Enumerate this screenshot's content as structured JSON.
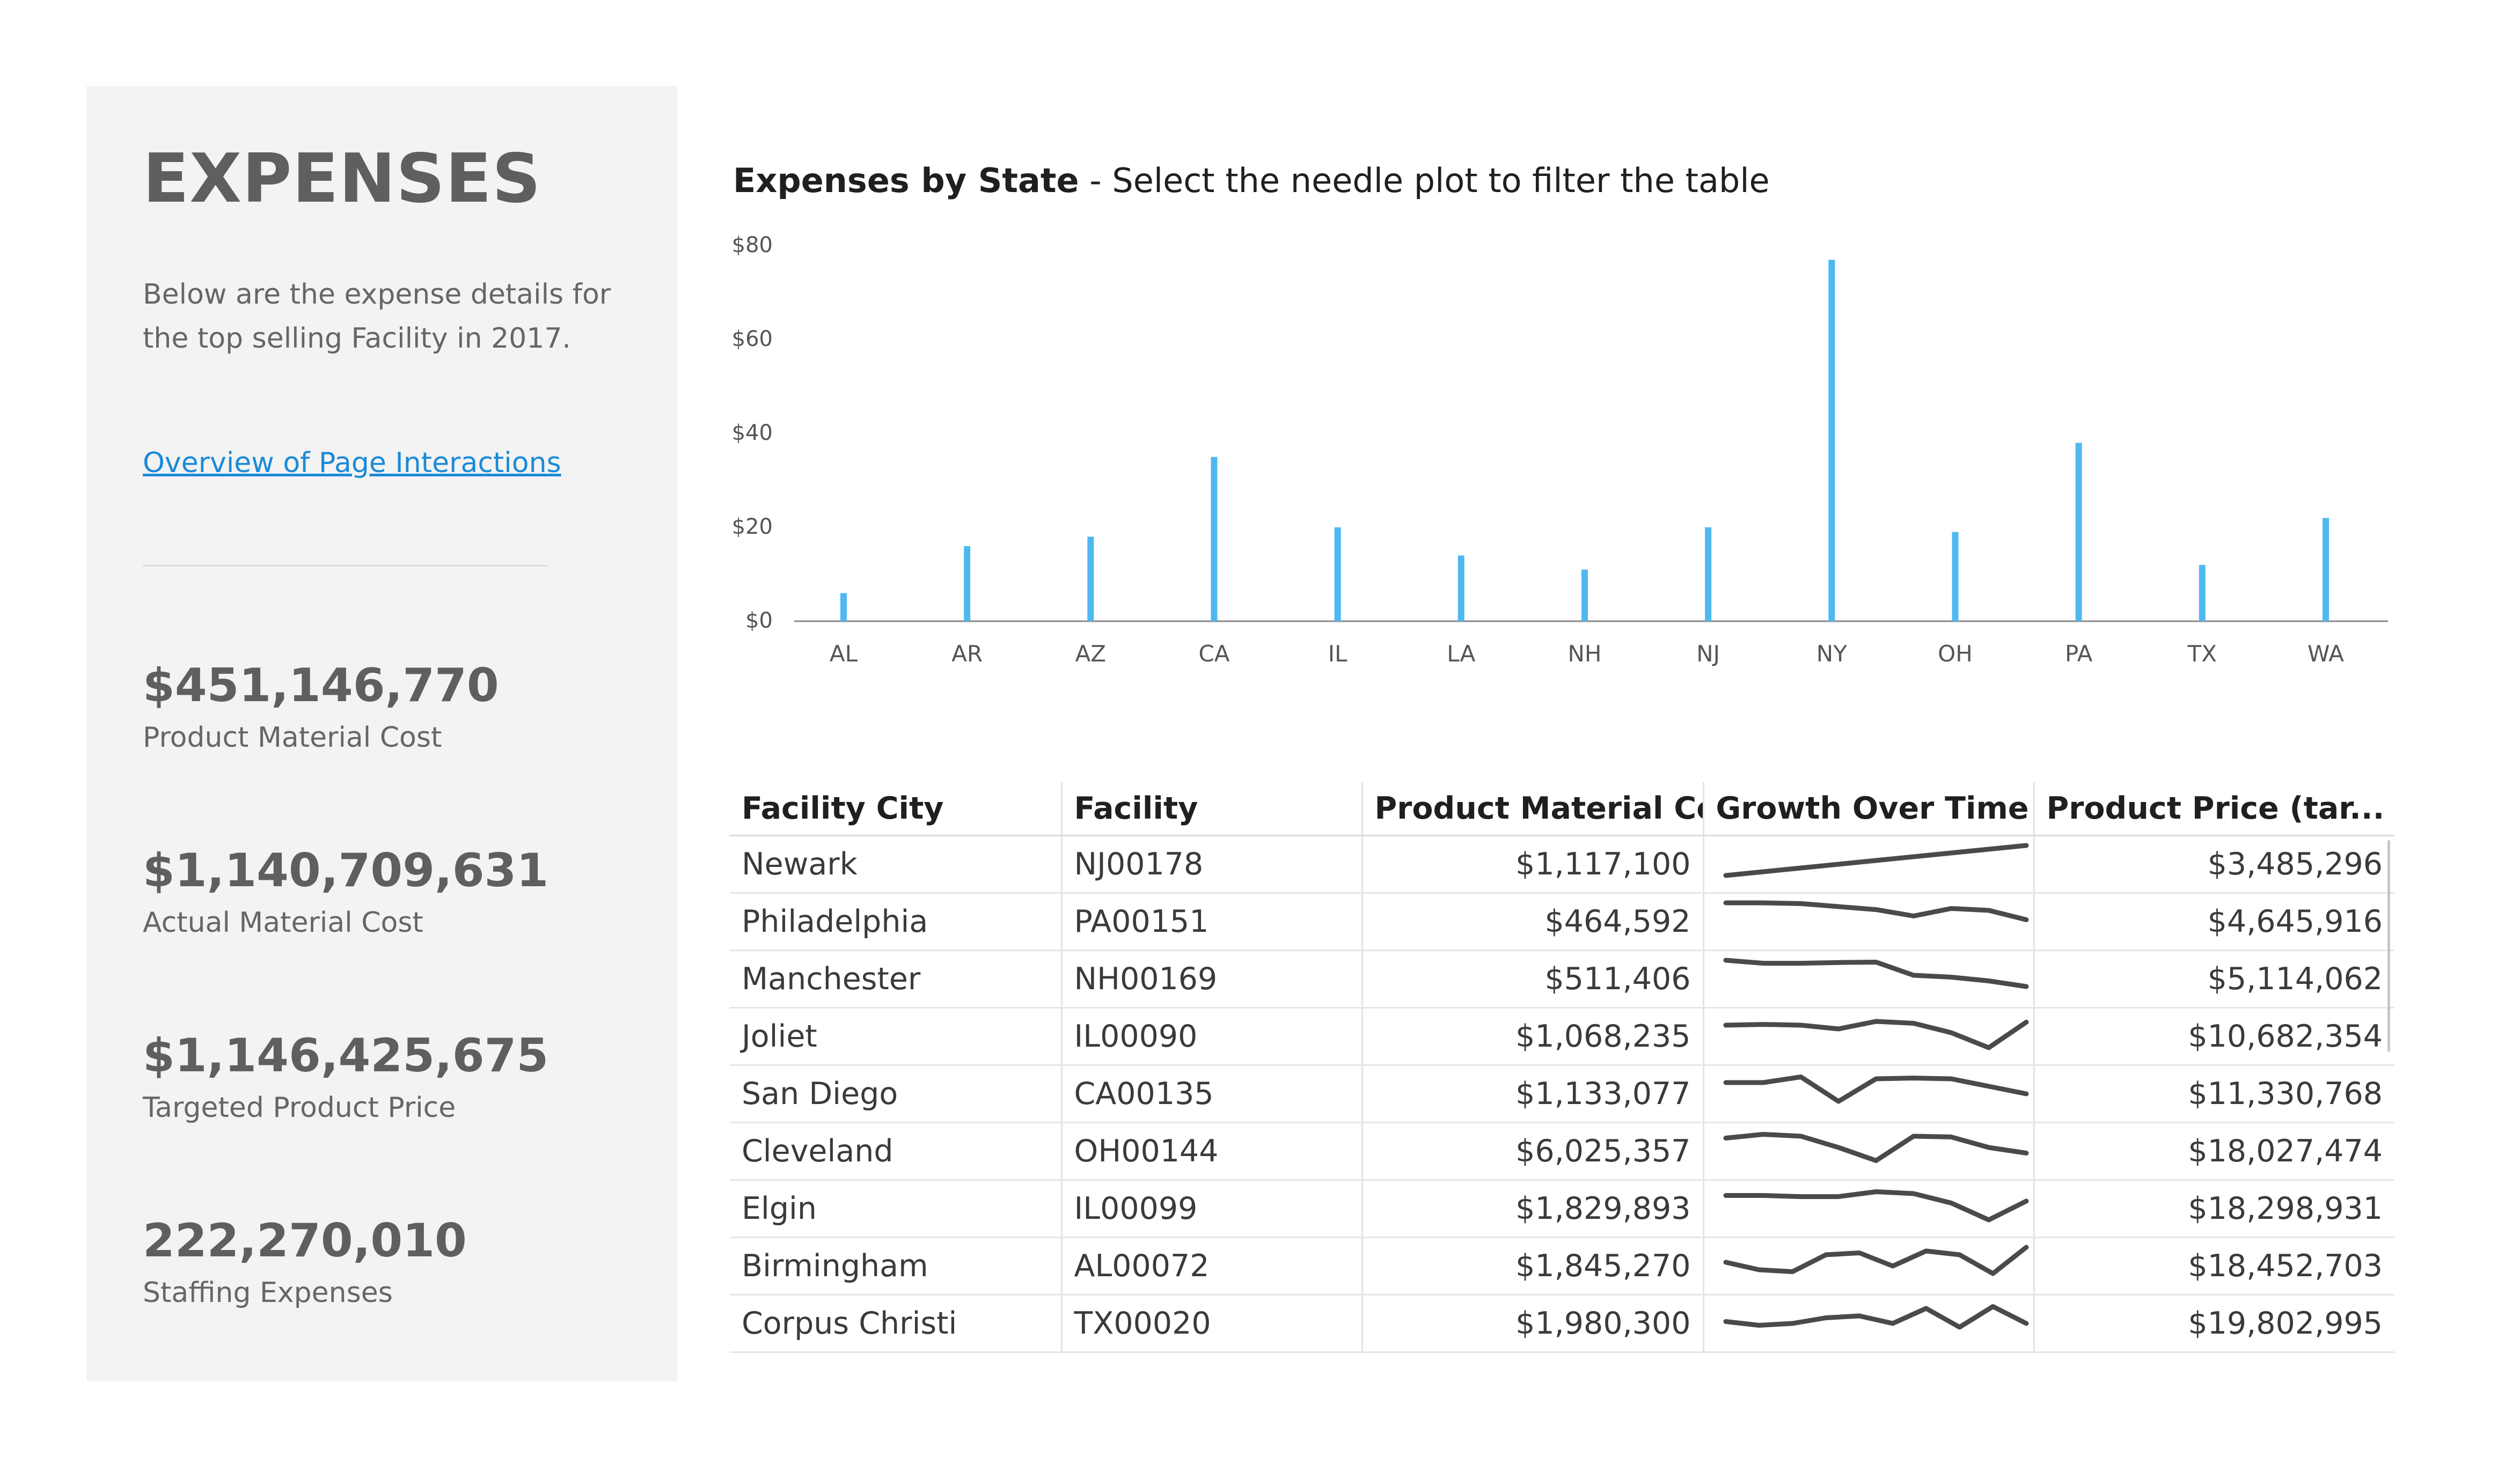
{
  "sidebar": {
    "title": "EXPENSES",
    "description": "Below are the expense details for the top selling Facility in 2017.",
    "link": "Overview of Page Interactions",
    "kpis": [
      {
        "value": "$451,146,770",
        "label": "Product Material Cost"
      },
      {
        "value": "$1,140,709,631",
        "label": "Actual Material Cost"
      },
      {
        "value": "$1,146,425,675",
        "label": "Targeted Product Price"
      },
      {
        "value": "222,270,010",
        "label": "Staffing Expenses"
      }
    ]
  },
  "chart": {
    "title_bold": "Expenses by State",
    "title_rest": " - Select the needle plot to filter the table"
  },
  "chart_data": {
    "type": "bar",
    "style": "needle",
    "title": "Expenses by State - Select the needle plot to filter the table",
    "xlabel": "",
    "ylabel": "",
    "categories": [
      "AL",
      "AR",
      "AZ",
      "CA",
      "IL",
      "LA",
      "NH",
      "NJ",
      "NY",
      "OH",
      "PA",
      "TX",
      "WA"
    ],
    "values": [
      6,
      16,
      18,
      35,
      20,
      14,
      11,
      20,
      77,
      19,
      38,
      12,
      22
    ],
    "ylim": [
      0,
      80
    ],
    "yticks": [
      "$0",
      "$20",
      "$40",
      "$60",
      "$80"
    ],
    "color": "#4fb8f0",
    "grid": false
  },
  "table": {
    "columns": [
      "Facility City",
      "Facility",
      "Product Material Cost",
      "Growth Over Time",
      "Product Price (tar..."
    ],
    "sort_indicator": "▲",
    "green_color": "#72b526",
    "rows": [
      {
        "city": "Newark",
        "facility": "NJ00178",
        "cost": "$1,117,100",
        "green": true,
        "price": "$3,485,296",
        "spark": [
          0.1,
          0.2,
          0.3,
          0.4,
          0.5,
          0.6,
          0.7,
          0.8,
          0.9
        ]
      },
      {
        "city": "Philadelphia",
        "facility": "PA00151",
        "cost": "$464,592",
        "green": false,
        "price": "$4,645,916",
        "spark": [
          0.9,
          0.9,
          0.88,
          0.8,
          0.72,
          0.55,
          0.75,
          0.7,
          0.45
        ]
      },
      {
        "city": "Manchester",
        "facility": "NH00169",
        "cost": "$511,406",
        "green": false,
        "price": "$5,114,062",
        "spark": [
          0.9,
          0.82,
          0.82,
          0.84,
          0.85,
          0.5,
          0.45,
          0.35,
          0.2
        ]
      },
      {
        "city": "Joliet",
        "facility": "IL00090",
        "cost": "$1,068,235",
        "green": true,
        "price": "$10,682,354",
        "spark": [
          0.7,
          0.72,
          0.7,
          0.6,
          0.8,
          0.75,
          0.5,
          0.1,
          0.78
        ]
      },
      {
        "city": "San Diego",
        "facility": "CA00135",
        "cost": "$1,133,077",
        "green": true,
        "price": "$11,330,768",
        "spark": [
          0.7,
          0.7,
          0.85,
          0.2,
          0.8,
          0.82,
          0.8,
          0.6,
          0.4
        ]
      },
      {
        "city": "Cleveland",
        "facility": "OH00144",
        "cost": "$6,025,357",
        "green": true,
        "price": "$18,027,474",
        "spark": [
          0.75,
          0.85,
          0.8,
          0.5,
          0.15,
          0.8,
          0.78,
          0.5,
          0.35
        ]
      },
      {
        "city": "Elgin",
        "facility": "IL00099",
        "cost": "$1,829,893",
        "green": true,
        "price": "$18,298,931",
        "spark": [
          0.75,
          0.75,
          0.72,
          0.72,
          0.85,
          0.8,
          0.55,
          0.1,
          0.6
        ]
      },
      {
        "city": "Birmingham",
        "facility": "AL00072",
        "cost": "$1,845,270",
        "green": true,
        "price": "$18,452,703",
        "spark": [
          0.5,
          0.3,
          0.25,
          0.7,
          0.75,
          0.4,
          0.8,
          0.7,
          0.2,
          0.9
        ]
      },
      {
        "city": "Corpus Christi",
        "facility": "TX00020",
        "cost": "$1,980,300",
        "green": true,
        "price": "$19,802,995",
        "spark": [
          0.45,
          0.35,
          0.4,
          0.55,
          0.6,
          0.4,
          0.8,
          0.3,
          0.85,
          0.4
        ]
      }
    ]
  }
}
